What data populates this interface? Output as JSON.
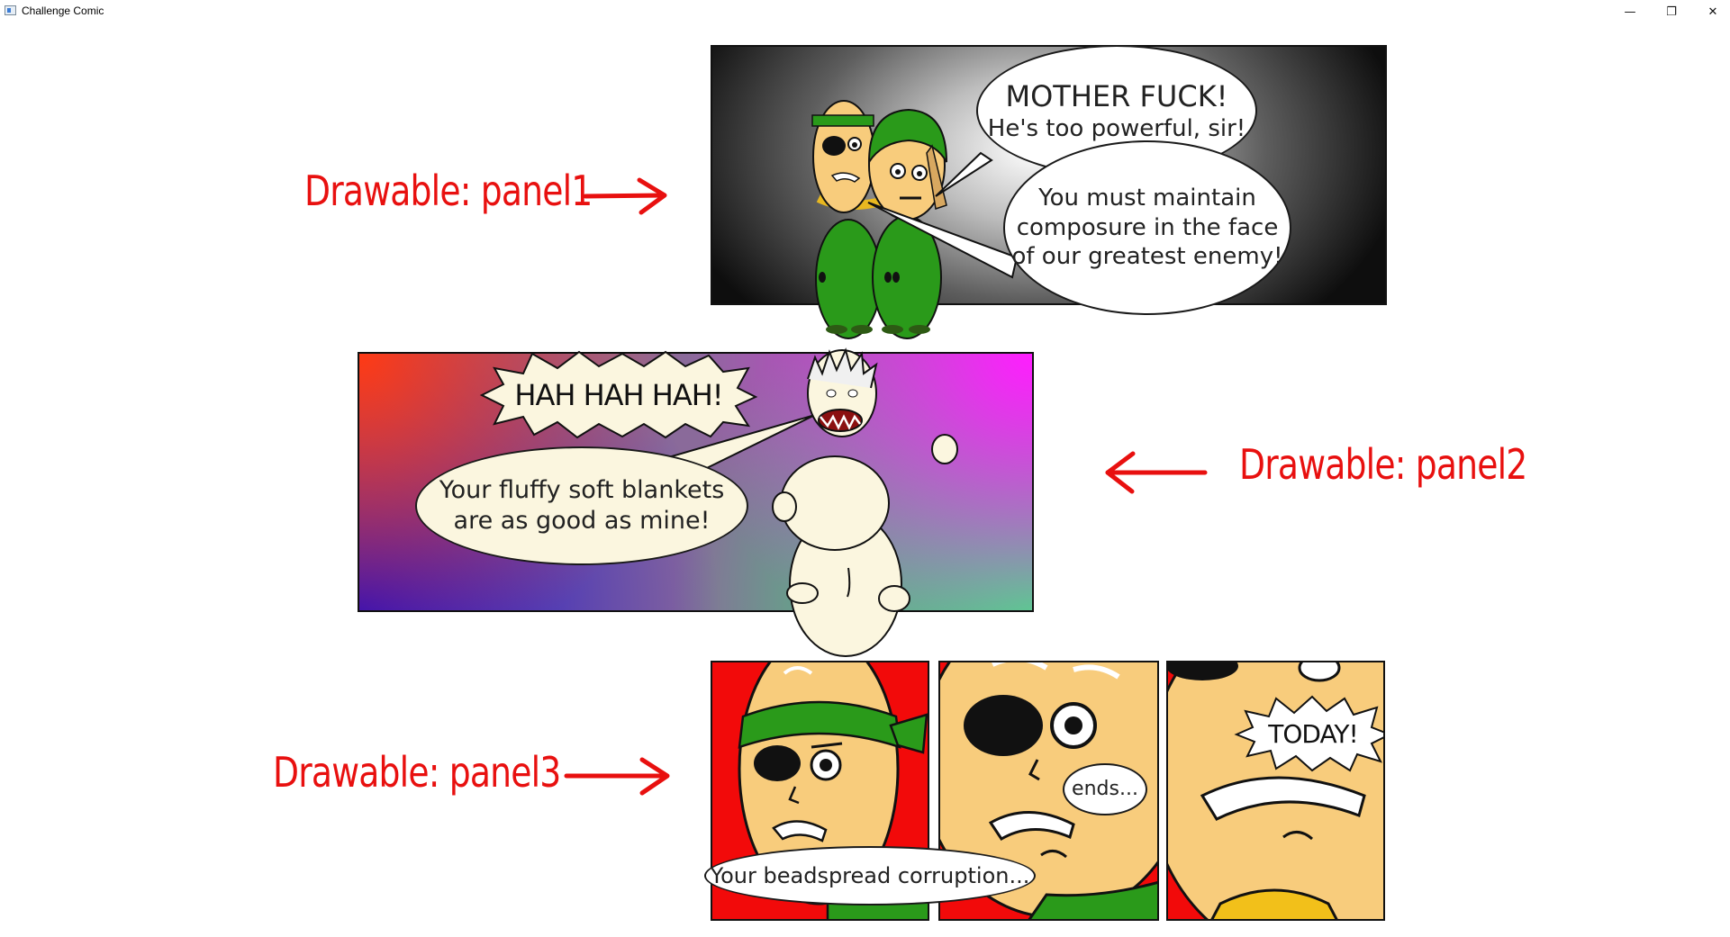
{
  "window": {
    "title": "Challenge Comic",
    "controls": {
      "minimize": "—",
      "maximize": "❐",
      "close": "✕"
    }
  },
  "annotations": {
    "panel1": "Drawable: panel1",
    "panel2": "Drawable: panel2",
    "panel3": "Drawable: panel3"
  },
  "panel1": {
    "bubble_top": {
      "line1": "MOTHER FUCK!",
      "line2": "He's too powerful, sir!"
    },
    "bubble_bottom": {
      "line1": "You must maintain",
      "line2": "composure in the face",
      "line3": "of our greatest enemy!"
    }
  },
  "panel2": {
    "shout": "HAH HAH HAH!",
    "bubble": {
      "line1": "Your fluffy soft blankets",
      "line2": "are as good as mine!"
    }
  },
  "panel3": {
    "bubble_a": "Your beadspread corruption...",
    "bubble_b": "ends...",
    "shout_c": "TODAY!"
  },
  "colors": {
    "annotation": "#e8100f",
    "panel3_background": "#f20a0a",
    "skin": "#f8cc7c",
    "uniform_green": "#2a9a1a"
  }
}
